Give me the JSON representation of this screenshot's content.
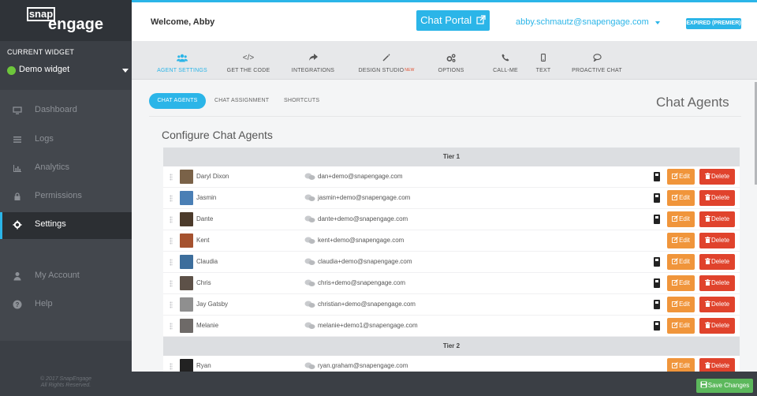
{
  "app": {
    "logo_top": "snap",
    "logo_bottom": "engage",
    "welcome": "Welcome, Abby",
    "portal_label": "Chat Portal",
    "user_email": "abby.schmautz@snapengage.com",
    "plan_badge": "EXPIRED (PREMIER)"
  },
  "sidebar": {
    "current_widget_label": "CURRENT WIDGET",
    "widget_name": "Demo widget",
    "items": [
      {
        "label": "Dashboard",
        "icon": "monitor-icon",
        "active": false
      },
      {
        "label": "Logs",
        "icon": "list-icon",
        "active": false
      },
      {
        "label": "Analytics",
        "icon": "bar-chart-icon",
        "active": false
      },
      {
        "label": "Permissions",
        "icon": "lock-icon",
        "active": false
      },
      {
        "label": "Settings",
        "icon": "gear-icon",
        "active": true
      },
      {
        "label": "My Account",
        "icon": "user-icon",
        "active": false
      },
      {
        "label": "Help",
        "icon": "question-icon",
        "active": false
      }
    ],
    "copyright_line1": "© 2017 SnapEngage",
    "copyright_line2": "All Rights Reserved."
  },
  "toolbar": {
    "tabs": [
      {
        "label": "AGENT SETTINGS",
        "icon": "users-icon",
        "active": true
      },
      {
        "label": "GET THE CODE",
        "icon": "code-icon",
        "active": false
      },
      {
        "label": "INTEGRATIONS",
        "icon": "share-icon",
        "active": false
      },
      {
        "label": "DESIGN STUDIO",
        "icon": "magic-wand-icon",
        "active": false,
        "tag": "NEW"
      },
      {
        "label": "OPTIONS",
        "icon": "cogs-icon",
        "active": false
      },
      {
        "label": "CALL-ME",
        "icon": "phone-icon",
        "active": false
      },
      {
        "label": "TEXT",
        "icon": "mobile-icon",
        "active": false
      },
      {
        "label": "PROACTIVE CHAT",
        "icon": "comment-icon",
        "active": false
      }
    ]
  },
  "subtabs": {
    "items": [
      "CHAT AGENTS",
      "CHAT ASSIGNMENT",
      "SHORTCUTS"
    ],
    "active": "CHAT AGENTS"
  },
  "content": {
    "section_title": "Chat Agents",
    "configure_title": "Configure Chat Agents",
    "tier1_label": "Tier 1",
    "tier2_label": "Tier 2",
    "edit_label": "Edit",
    "delete_label": "Delete",
    "agents": [
      {
        "name": "Daryl Dixon",
        "email": "dan+demo@snapengage.com",
        "phone": true,
        "avatar_color": "#7a6248"
      },
      {
        "name": "Jasmin",
        "email": "jasmin+demo@snapengage.com",
        "phone": true,
        "avatar_color": "#4a7fb5"
      },
      {
        "name": "Dante",
        "email": "dante+demo@snapengage.com",
        "phone": true,
        "avatar_color": "#4c3b2b"
      },
      {
        "name": "Kent",
        "email": "kent+demo@snapengage.com",
        "phone": false,
        "avatar_color": "#a5522f"
      },
      {
        "name": "Claudia",
        "email": "claudia+demo@snapengage.com",
        "phone": true,
        "avatar_color": "#3d6e9c"
      },
      {
        "name": "Chris",
        "email": "chris+demo@snapengage.com",
        "phone": true,
        "avatar_color": "#5d5148"
      },
      {
        "name": "Jay Gatsby",
        "email": "christian+demo@snapengage.com",
        "phone": true,
        "avatar_color": "#8f8f8f"
      },
      {
        "name": "Melanie",
        "email": "melanie+demo1@snapengage.com",
        "phone": true,
        "avatar_color": "#6e6a68"
      }
    ],
    "tier2_agents": [
      {
        "name": "Ryan",
        "email": "ryan.graham@snapengage.com",
        "phone": false,
        "avatar_color": "#222222"
      }
    ]
  },
  "footer": {
    "save_label": "Save Changes"
  },
  "colors": {
    "accent": "#2bb5e8",
    "edit": "#f0953b",
    "delete": "#e0432c",
    "save": "#5cb85c",
    "widget_online": "#6dc63b"
  }
}
